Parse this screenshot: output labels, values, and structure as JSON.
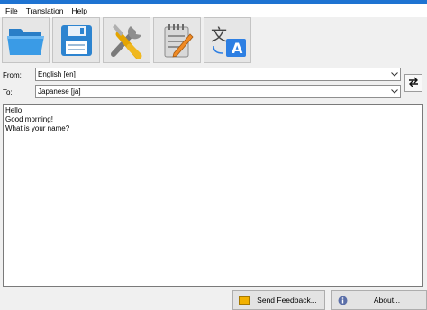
{
  "menu": {
    "file": "File",
    "translation": "Translation",
    "help": "Help"
  },
  "toolbar": {
    "buttons": [
      {
        "icon": "folder-open-icon"
      },
      {
        "icon": "floppy-disk-icon"
      },
      {
        "icon": "tools-icon"
      },
      {
        "icon": "notepad-pencil-icon"
      },
      {
        "icon": "translate-icon"
      }
    ],
    "translate_glyph_source": "文",
    "translate_glyph_target": "A"
  },
  "from": {
    "label": "From:",
    "value": "English [en]"
  },
  "to": {
    "label": "To:",
    "value": "Japanese [ja]"
  },
  "input_text": {
    "lines": [
      "Hello.",
      "Good morning!",
      "What is your name?"
    ]
  },
  "footer": {
    "send_feedback": "Send Feedback...",
    "about": "About..."
  },
  "colors": {
    "accent": "#1e73d2",
    "folder": "#2f8fd8",
    "translate_bg": "#2d7fe3"
  }
}
